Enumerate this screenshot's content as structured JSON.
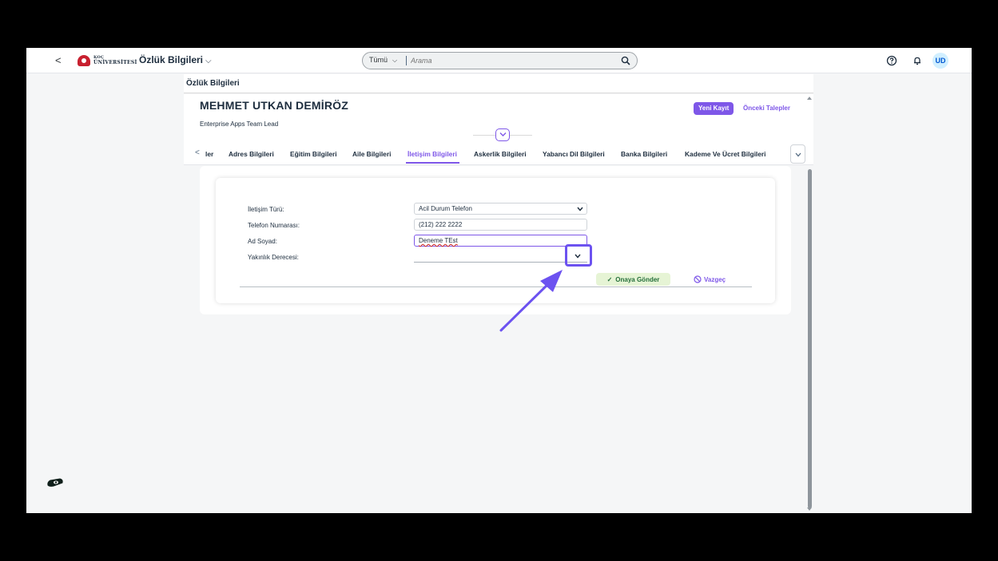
{
  "shell": {
    "back_label": "<",
    "logo_line1": "KOÇ",
    "logo_line2": "ÜNİVERSİTESİ",
    "app_title": "Özlük Bilgileri",
    "app_title_chevron": "⌵",
    "search_scope": "Tümü",
    "search_scope_chevron": "⌵",
    "search_placeholder": "Arama",
    "user_initials": "UD"
  },
  "page": {
    "title": "Özlük Bilgileri",
    "employee_name": "MEHMET UTKAN DEMİRÖZ",
    "employee_role": "Enterprise Apps Team Lead",
    "new_record_label": "Yeni Kayıt",
    "previous_requests_label": "Önceki Talepler"
  },
  "tabs": {
    "scroll_left": "<",
    "items": [
      {
        "label": "ler"
      },
      {
        "label": "Adres Bilgileri"
      },
      {
        "label": "Eğitim Bilgileri"
      },
      {
        "label": "Aile Bilgileri"
      },
      {
        "label": "İletişim Bilgileri",
        "active": true
      },
      {
        "label": "Askerlik Bilgileri"
      },
      {
        "label": "Yabancı Dil Bilgileri"
      },
      {
        "label": "Banka Bilgileri"
      },
      {
        "label": "Kademe Ve Ücret Bilgileri"
      }
    ]
  },
  "form": {
    "fields": [
      {
        "label": "İletişim Türü:",
        "value": "Acil Durum Telefon",
        "type": "select"
      },
      {
        "label": "Telefon Numarası:",
        "value": "(212) 222 2222",
        "type": "input"
      },
      {
        "label": "Ad Soyad:",
        "value": "Deneme TEst",
        "type": "input",
        "focused": true
      },
      {
        "label": "Yakınlık Derecesi:",
        "value": "",
        "type": "select"
      }
    ],
    "submit_label": "Onaya Gönder",
    "submit_check": "✓",
    "cancel_label": "Vazgeç"
  },
  "colors": {
    "accent": "#7e57e8",
    "highlight": "#6c52f0",
    "submit_bg": "#e6f4d5",
    "submit_text": "#256f3a"
  },
  "icons": {
    "search": "magnifier-icon",
    "help": "question-circle-icon",
    "notifications": "bell-icon",
    "collapse": "chevron-down-icon",
    "cancel": "no-entry-icon",
    "assistant": "assistant-icon"
  }
}
